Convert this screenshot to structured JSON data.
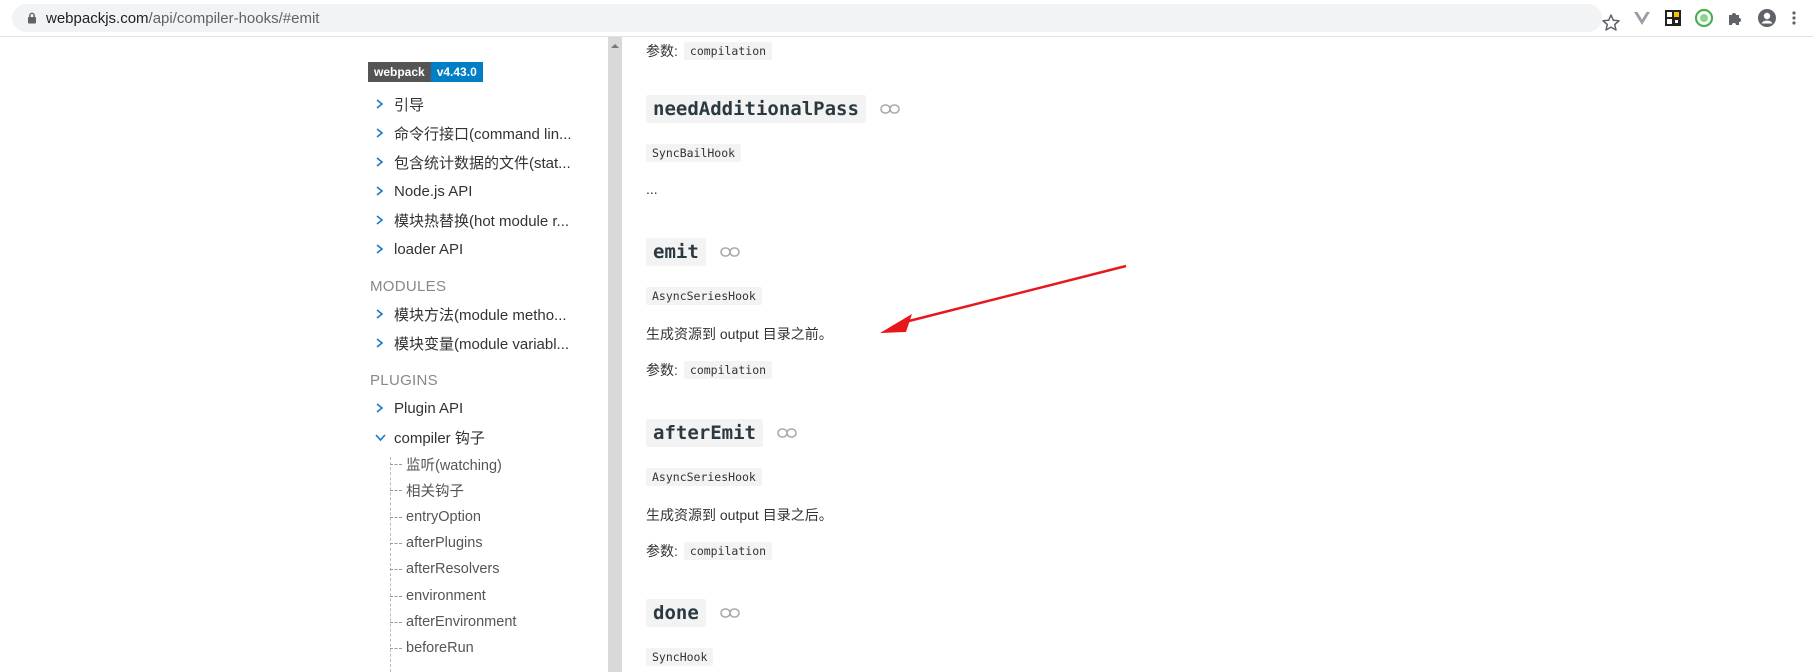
{
  "browser": {
    "url_host": "webpackjs.com",
    "url_path": "/api/compiler-hooks/#emit"
  },
  "sidebar": {
    "badge_name": "webpack",
    "badge_version": "v4.43.0",
    "api_items": [
      {
        "label": "引导"
      },
      {
        "label": "命令行接口(command lin..."
      },
      {
        "label": "包含统计数据的文件(stat..."
      },
      {
        "label": "Node.js API"
      },
      {
        "label": "模块热替换(hot module r..."
      },
      {
        "label": "loader API"
      }
    ],
    "modules_heading": "MODULES",
    "module_items": [
      {
        "label": "模块方法(module metho..."
      },
      {
        "label": "模块变量(module variabl..."
      }
    ],
    "plugins_heading": "PLUGINS",
    "plugin_items": [
      {
        "label": "Plugin API"
      },
      {
        "label": "compiler 钩子"
      }
    ],
    "sub_items": [
      {
        "label": "监听(watching)"
      },
      {
        "label": "相关钩子"
      },
      {
        "label": "entryOption"
      },
      {
        "label": "afterPlugins"
      },
      {
        "label": "afterResolvers"
      },
      {
        "label": "environment"
      },
      {
        "label": "afterEnvironment"
      },
      {
        "label": "beforeRun"
      }
    ]
  },
  "main": {
    "param_label": "参数:",
    "top_param": "compilation",
    "hooks": [
      {
        "name": "needAdditionalPass",
        "type": "SyncBailHook",
        "desc": "..."
      },
      {
        "name": "emit",
        "type": "AsyncSeriesHook",
        "desc": "生成资源到 output 目录之前。",
        "param": "compilation"
      },
      {
        "name": "afterEmit",
        "type": "AsyncSeriesHook",
        "desc": "生成资源到 output 目录之后。",
        "param": "compilation"
      },
      {
        "name": "done",
        "type": "SyncHook"
      }
    ]
  },
  "colors": {
    "badge_version_bg": "#007ec6",
    "annotation_arrow": "#e8171b"
  }
}
